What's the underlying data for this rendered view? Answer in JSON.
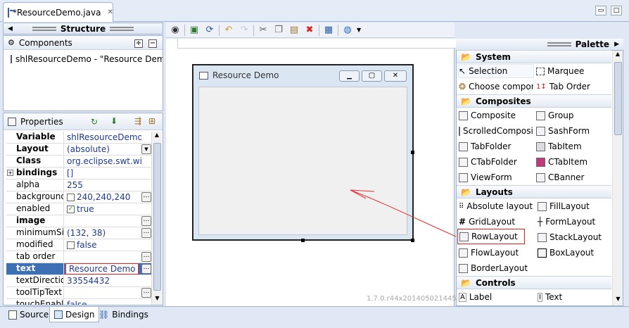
{
  "editor_tab": {
    "title": "*ResourceDemo.java",
    "close": "✕"
  },
  "window_buttons": {
    "minimize": "▭",
    "maximize": "□"
  },
  "structure": {
    "title": "Structure",
    "components_label": "Components",
    "tree_item": "shlResourceDemo - \"Resource Demo\""
  },
  "properties": {
    "title": "Properties",
    "rows": [
      {
        "name": "Variable",
        "value": "shlResourceDemo"
      },
      {
        "name": "Layout",
        "value": "(absolute)"
      },
      {
        "name": "Class",
        "value": "org.eclipse.swt.widgets.Shell"
      },
      {
        "name": "bindings",
        "value": "[]"
      },
      {
        "name": "alpha",
        "value": "255"
      },
      {
        "name": "background",
        "value": "240,240,240"
      },
      {
        "name": "enabled",
        "value": "true"
      },
      {
        "name": "image",
        "value": ""
      },
      {
        "name": "minimumSize",
        "value": "(132, 38)"
      },
      {
        "name": "modified",
        "value": "false"
      },
      {
        "name": "tab order",
        "value": ""
      },
      {
        "name": "text",
        "value": "Resource Demo"
      },
      {
        "name": "textDirection",
        "value": "33554432"
      },
      {
        "name": "toolTipText",
        "value": ""
      },
      {
        "name": "touchEnabled",
        "value": "false"
      }
    ]
  },
  "design": {
    "shell_title": "Resource Demo",
    "version": "1.7.0.r44x201405021445"
  },
  "palette": {
    "title": "Palette",
    "sections": [
      {
        "name": "System",
        "items": [
          "Selection",
          "Marquee",
          "Choose component...",
          "Tab Order"
        ]
      },
      {
        "name": "Composites",
        "items": [
          "Composite",
          "Group",
          "ScrolledComposite",
          "SashForm",
          "TabFolder",
          "TabItem",
          "CTabFolder",
          "CTabItem",
          "ViewForm",
          "CBanner"
        ]
      },
      {
        "name": "Layouts",
        "items": [
          "Absolute layout",
          "FillLayout",
          "GridLayout",
          "FormLayout",
          "RowLayout",
          "StackLayout",
          "FlowLayout",
          "BoxLayout",
          "BorderLayout"
        ]
      },
      {
        "name": "Controls",
        "items": [
          "Label",
          "Text"
        ]
      }
    ]
  },
  "bottom_tabs": [
    "Source",
    "Design",
    "Bindings"
  ]
}
